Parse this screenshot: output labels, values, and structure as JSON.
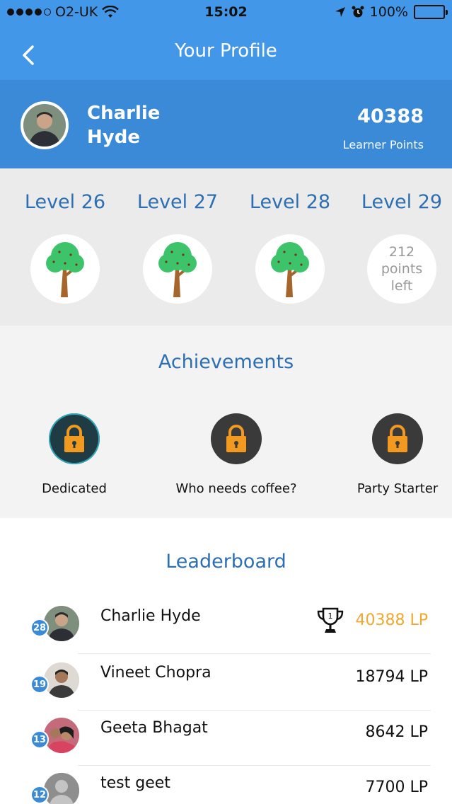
{
  "status_bar": {
    "carrier": "O2-UK",
    "time": "15:02",
    "battery": "100%"
  },
  "nav": {
    "title": "Your Profile",
    "back_icon": "chevron-left-icon"
  },
  "profile": {
    "name": "Charlie Hyde",
    "points": "40388",
    "points_label": "Learner Points"
  },
  "levels": [
    {
      "label": "Level 26",
      "icon": "tree-icon",
      "achieved": true
    },
    {
      "label": "Level 27",
      "icon": "tree-icon",
      "achieved": true
    },
    {
      "label": "Level 28",
      "icon": "tree-icon",
      "achieved": true
    },
    {
      "label": "Level 29",
      "achieved": false,
      "points_left": "212",
      "points_left_line2": "points",
      "points_left_line3": "left"
    }
  ],
  "achievements": {
    "title": "Achievements",
    "items": [
      {
        "label": "Dedicated",
        "icon": "lock-icon",
        "color": "#1f3c44"
      },
      {
        "label": "Who needs coffee?",
        "icon": "lock-icon",
        "color": "#3a3a3a"
      },
      {
        "label": "Party Starter",
        "icon": "lock-icon",
        "color": "#3a3a3a"
      }
    ]
  },
  "leaderboard": {
    "title": "Leaderboard",
    "rows": [
      {
        "level": "28",
        "name": "Charlie Hyde",
        "score": "40388 LP",
        "trophy": true
      },
      {
        "level": "19",
        "name": "Vineet Chopra",
        "score": "18794 LP"
      },
      {
        "level": "13",
        "name": "Geeta Bhagat",
        "score": "8642 LP"
      },
      {
        "level": "12",
        "name": "test geet",
        "score": "7700 LP"
      }
    ]
  },
  "colors": {
    "nav_blue": "#4297e8",
    "profile_blue": "#3a8ad8",
    "title_blue": "#2d6fb2",
    "gold": "#f0a830"
  }
}
